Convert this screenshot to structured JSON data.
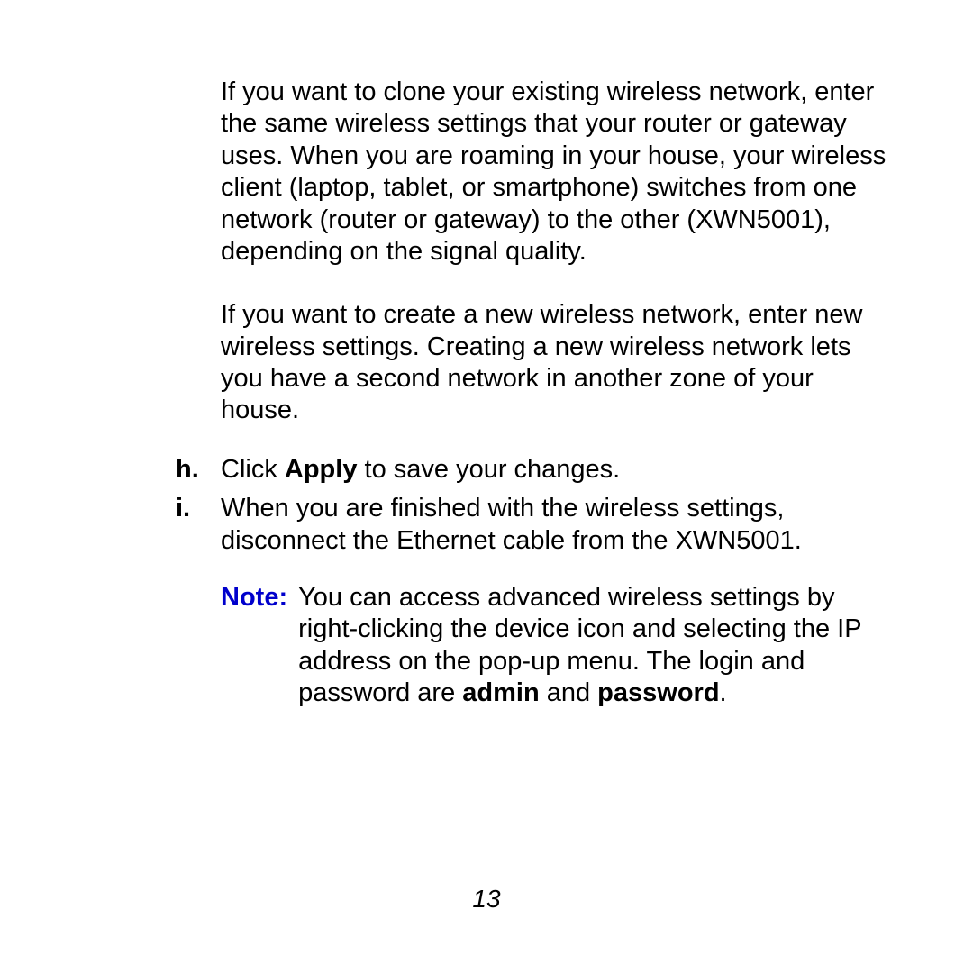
{
  "para1": "If you want to clone your existing wireless network, enter the same wireless settings that your router or gateway uses. When you are roaming in your house, your wireless client (laptop, tablet, or smartphone) switches from one network (router or gateway) to the other (XWN5001), depending on the signal quality.",
  "para2": "If you want to create a new wireless network, enter new wireless settings. Creating a new wireless network lets you have a second network in another zone of your house.",
  "item_h": {
    "marker": "h.",
    "pre": "Click ",
    "bold": "Apply",
    "post": " to save your changes."
  },
  "item_i": {
    "marker": "i.",
    "text": "When you are finished with the wireless settings, disconnect the Ethernet cable from the XWN5001."
  },
  "note": {
    "label": "Note:",
    "pre": "You can access advanced wireless settings by right-clicking the device icon and selecting the IP address on the pop-up menu. The login and password are ",
    "b1": "admin",
    "mid": " and ",
    "b2": "password",
    "post": "."
  },
  "page": "13"
}
